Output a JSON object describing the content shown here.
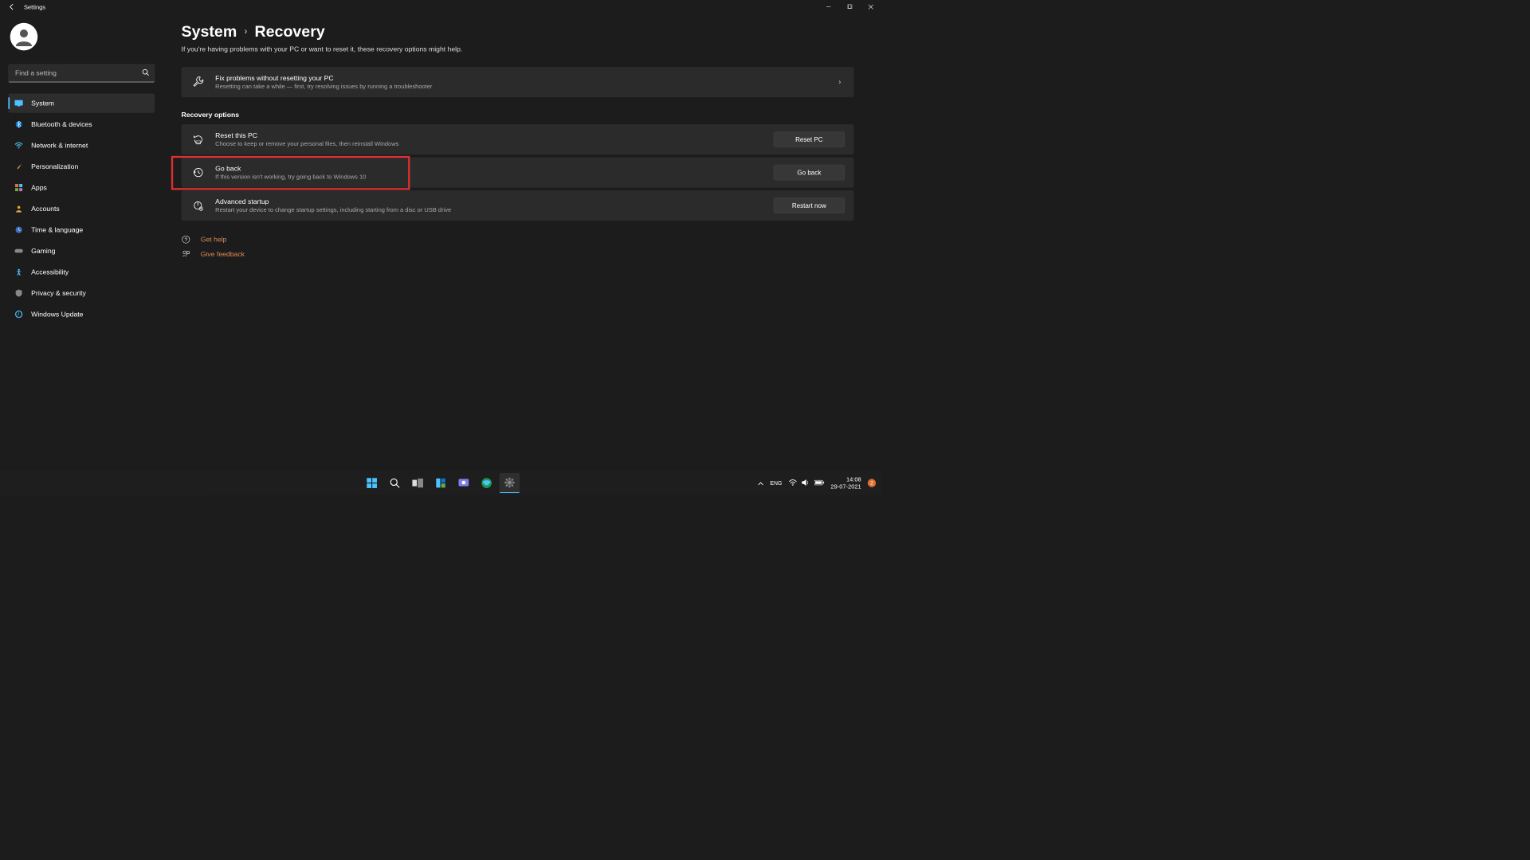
{
  "window": {
    "title": "Settings"
  },
  "search": {
    "placeholder": "Find a setting"
  },
  "sidebar": {
    "items": [
      {
        "label": "System",
        "icon": "💻",
        "active": true
      },
      {
        "label": "Bluetooth & devices",
        "icon": "bt"
      },
      {
        "label": "Network & internet",
        "icon": "wifi"
      },
      {
        "label": "Personalization",
        "icon": "brush"
      },
      {
        "label": "Apps",
        "icon": "apps"
      },
      {
        "label": "Accounts",
        "icon": "person"
      },
      {
        "label": "Time & language",
        "icon": "clock"
      },
      {
        "label": "Gaming",
        "icon": "gamepad"
      },
      {
        "label": "Accessibility",
        "icon": "access"
      },
      {
        "label": "Privacy & security",
        "icon": "shield"
      },
      {
        "label": "Windows Update",
        "icon": "update"
      }
    ]
  },
  "breadcrumb": {
    "parent": "System",
    "current": "Recovery"
  },
  "subtitle": "If you're having problems with your PC or want to reset it, these recovery options might help.",
  "fix_card": {
    "title": "Fix problems without resetting your PC",
    "desc": "Resetting can take a while — first, try resolving issues by running a troubleshooter"
  },
  "recovery_section": {
    "title": "Recovery options"
  },
  "reset_card": {
    "title": "Reset this PC",
    "desc": "Choose to keep or remove your personal files, then reinstall Windows",
    "button": "Reset PC"
  },
  "goback_card": {
    "title": "Go back",
    "desc": "If this version isn't working, try going back to Windows 10",
    "button": "Go back"
  },
  "advanced_card": {
    "title": "Advanced startup",
    "desc": "Restart your device to change startup settings, including starting from a disc or USB drive",
    "button": "Restart now"
  },
  "help": {
    "get_help": "Get help",
    "feedback": "Give feedback"
  },
  "tray": {
    "lang": "ENG",
    "time": "14:08",
    "date": "29-07-2021",
    "notif_count": "2"
  }
}
